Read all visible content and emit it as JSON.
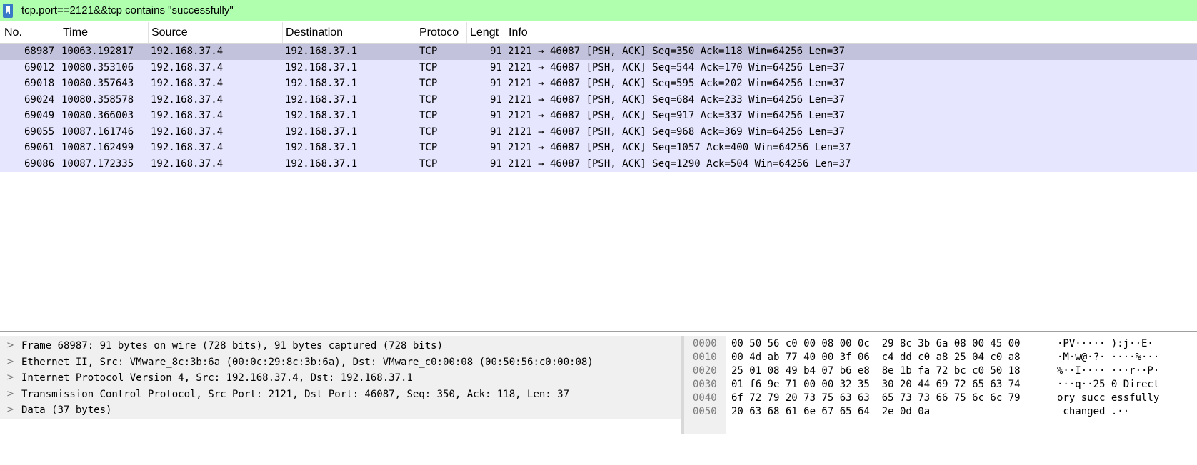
{
  "filter": {
    "value": "tcp.port==2121&&tcp contains \"successfully\""
  },
  "columns": [
    "No.",
    "Time",
    "Source",
    "Destination",
    "Protoco",
    "Lengt",
    "Info"
  ],
  "packets": [
    {
      "no": "68987",
      "time": "10063.192817",
      "src": "192.168.37.4",
      "dst": "192.168.37.1",
      "proto": "TCP",
      "len": "91",
      "info": "2121 → 46087 [PSH, ACK] Seq=350 Ack=118 Win=64256 Len=37"
    },
    {
      "no": "69012",
      "time": "10080.353106",
      "src": "192.168.37.4",
      "dst": "192.168.37.1",
      "proto": "TCP",
      "len": "91",
      "info": "2121 → 46087 [PSH, ACK] Seq=544 Ack=170 Win=64256 Len=37"
    },
    {
      "no": "69018",
      "time": "10080.357643",
      "src": "192.168.37.4",
      "dst": "192.168.37.1",
      "proto": "TCP",
      "len": "91",
      "info": "2121 → 46087 [PSH, ACK] Seq=595 Ack=202 Win=64256 Len=37"
    },
    {
      "no": "69024",
      "time": "10080.358578",
      "src": "192.168.37.4",
      "dst": "192.168.37.1",
      "proto": "TCP",
      "len": "91",
      "info": "2121 → 46087 [PSH, ACK] Seq=684 Ack=233 Win=64256 Len=37"
    },
    {
      "no": "69049",
      "time": "10080.366003",
      "src": "192.168.37.4",
      "dst": "192.168.37.1",
      "proto": "TCP",
      "len": "91",
      "info": "2121 → 46087 [PSH, ACK] Seq=917 Ack=337 Win=64256 Len=37"
    },
    {
      "no": "69055",
      "time": "10087.161746",
      "src": "192.168.37.4",
      "dst": "192.168.37.1",
      "proto": "TCP",
      "len": "91",
      "info": "2121 → 46087 [PSH, ACK] Seq=968 Ack=369 Win=64256 Len=37"
    },
    {
      "no": "69061",
      "time": "10087.162499",
      "src": "192.168.37.4",
      "dst": "192.168.37.1",
      "proto": "TCP",
      "len": "91",
      "info": "2121 → 46087 [PSH, ACK] Seq=1057 Ack=400 Win=64256 Len=37"
    },
    {
      "no": "69086",
      "time": "10087.172335",
      "src": "192.168.37.4",
      "dst": "192.168.37.1",
      "proto": "TCP",
      "len": "91",
      "info": "2121 → 46087 [PSH, ACK] Seq=1290 Ack=504 Win=64256 Len=37"
    }
  ],
  "details": [
    "Frame 68987: 91 bytes on wire (728 bits), 91 bytes captured (728 bits)",
    "Ethernet II, Src: VMware_8c:3b:6a (00:0c:29:8c:3b:6a), Dst: VMware_c0:00:08 (00:50:56:c0:00:08)",
    "Internet Protocol Version 4, Src: 192.168.37.4, Dst: 192.168.37.1",
    "Transmission Control Protocol, Src Port: 2121, Dst Port: 46087, Seq: 350, Ack: 118, Len: 37",
    "Data (37 bytes)"
  ],
  "hex": [
    {
      "off": "0000",
      "bytes": "00 50 56 c0 00 08 00 0c  29 8c 3b 6a 08 00 45 00",
      "ascii": "·PV····· ):j··E·"
    },
    {
      "off": "0010",
      "bytes": "00 4d ab 77 40 00 3f 06  c4 dd c0 a8 25 04 c0 a8",
      "ascii": "·M·w@·?· ····%···"
    },
    {
      "off": "0020",
      "bytes": "25 01 08 49 b4 07 b6 e8  8e 1b fa 72 bc c0 50 18",
      "ascii": "%··I···· ···r··P·"
    },
    {
      "off": "0030",
      "bytes": "01 f6 9e 71 00 00 32 35  30 20 44 69 72 65 63 74",
      "ascii": "···q··25 0 Direct"
    },
    {
      "off": "0040",
      "bytes": "6f 72 79 20 73 75 63 63  65 73 73 66 75 6c 6c 79",
      "ascii": "ory succ essfully"
    },
    {
      "off": "0050",
      "bytes": "20 63 68 61 6e 67 65 64  2e 0d 0a",
      "ascii": " changed .··"
    }
  ]
}
